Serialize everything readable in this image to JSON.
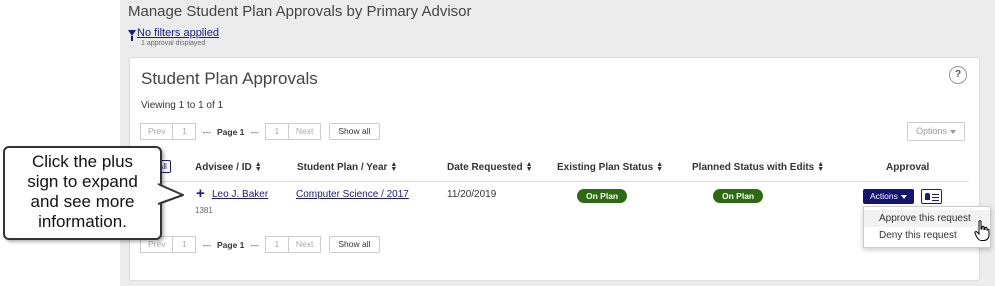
{
  "header": {
    "title": "Manage Student Plan Approvals by Primary Advisor",
    "filters_link": "No filters applied",
    "approvals_displayed": "1 approval displayed"
  },
  "card": {
    "title": "Student Plan Approvals",
    "help": "?",
    "viewing": "Viewing 1 to 1 of 1",
    "options_label": "Options"
  },
  "pager": {
    "prev": "Prev",
    "page_input": "1",
    "dots": "---",
    "page_label": "Page 1",
    "total": "1",
    "next": "Next",
    "show_all": "Show all"
  },
  "table": {
    "select_all": "All",
    "columns": [
      "Advisee / ID",
      "Student Plan / Year",
      "Date Requested",
      "Existing Plan Status",
      "Planned Status with Edits",
      "Approval"
    ],
    "rows": [
      {
        "expand": "+",
        "advisee": "Leo J. Baker",
        "id": "1381",
        "plan": "Computer Science / 2017",
        "date_requested": "11/20/2019",
        "existing_status": "On Plan",
        "planned_status": "On Plan"
      }
    ]
  },
  "actions": {
    "label": "Actions",
    "menu": [
      "Approve this request",
      "Deny this request"
    ]
  },
  "callout": {
    "lines": [
      "Click the plus",
      "sign to expand",
      "and see more",
      "information."
    ]
  },
  "colors": {
    "accent": "#1a1a8a",
    "status_green": "#2d6b12",
    "actions_bg": "#14146e"
  }
}
